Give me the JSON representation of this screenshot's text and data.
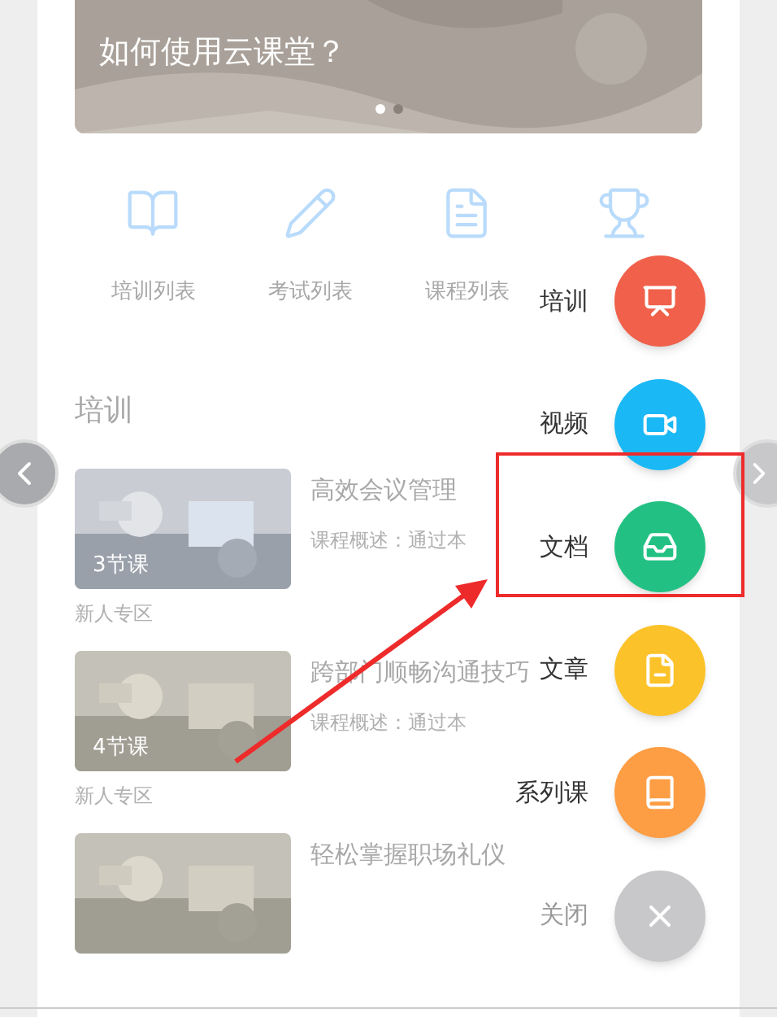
{
  "banner": {
    "title": "如何使用云课堂？",
    "dots": [
      {
        "selected": true
      },
      {
        "selected": false
      }
    ]
  },
  "shortcuts": [
    {
      "kind": "book",
      "label": "培训列表"
    },
    {
      "kind": "pencil",
      "label": "考试列表"
    },
    {
      "kind": "file",
      "label": "课程列表"
    },
    {
      "kind": "trophy"
    }
  ],
  "section": {
    "title": "培训"
  },
  "courses": [
    {
      "title": "高效会议管理",
      "description": "课程概述：通过本",
      "lessons": "3节课",
      "tag": "新人专区"
    },
    {
      "title": "跨部门顺畅沟通技巧",
      "description": "课程概述：通过本",
      "lessons": "4节课",
      "tag": "新人专区"
    },
    {
      "title": "轻松掌握职场礼仪"
    }
  ],
  "fab_menu": [
    {
      "kind": "training",
      "label": "培训",
      "color": "#f0604a"
    },
    {
      "kind": "video",
      "label": "视频",
      "color": "#1ab8f5"
    },
    {
      "kind": "document",
      "label": "文档",
      "color": "#22c183"
    },
    {
      "kind": "article",
      "label": "文章",
      "color": "#fcc22a"
    },
    {
      "kind": "series",
      "label": "系列课",
      "color": "#fd9d44"
    },
    {
      "kind": "close",
      "label": "关闭",
      "color": "#c8c8ca"
    }
  ]
}
